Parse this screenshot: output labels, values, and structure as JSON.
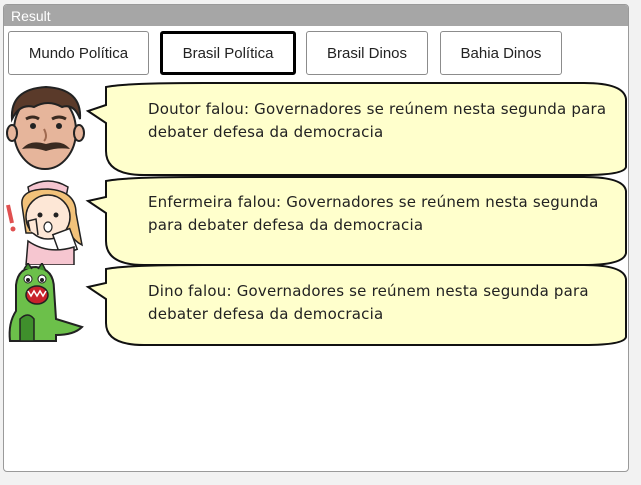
{
  "panel": {
    "title": "Result"
  },
  "tabs": [
    {
      "label": "Mundo Política"
    },
    {
      "label": "Brasil Política"
    },
    {
      "label": "Brasil Dinos"
    },
    {
      "label": "Bahia Dinos"
    }
  ],
  "messages": [
    {
      "avatar_icon": "doctor-face-icon",
      "text": "Doutor falou: Governadores se reúnem nesta segunda para debater defesa da democracia"
    },
    {
      "avatar_icon": "nurse-icon",
      "text": "Enfermeira falou: Governadores se reúnem nesta segunda para debater defesa da democracia"
    },
    {
      "avatar_icon": "dinosaur-icon",
      "text": "Dino falou: Governadores se reúnem nesta segunda para debater defesa da democracia"
    }
  ],
  "colors": {
    "bubble_fill": "#ffffcc",
    "bubble_stroke": "#111111",
    "header_bg": "#a6a6a6"
  }
}
